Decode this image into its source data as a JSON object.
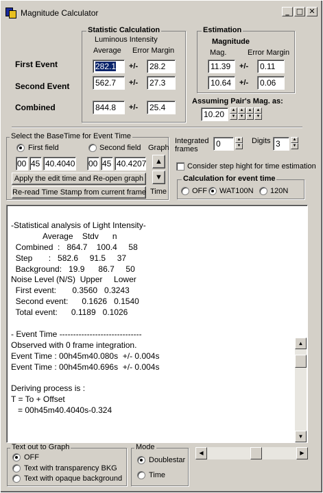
{
  "window": {
    "title": "Magnitude Calculator"
  },
  "statistic": {
    "title": "Statistic Calculation",
    "subtitle": "Luminous Intensity",
    "col_average": "Average",
    "col_error": "Error Margin",
    "row_first": "First Event",
    "row_second": "Second Event",
    "row_combined": "Combined",
    "pm": "+/-",
    "first_avg": "282.1",
    "first_err": "28.2",
    "second_avg": "562.7",
    "second_err": "27.3",
    "combined_avg": "844.8",
    "combined_err": "25.4"
  },
  "estimation": {
    "title": "Estimation",
    "subtitle": "Magnitude",
    "col_mag": "Mag.",
    "col_error": "Error Margin",
    "first_mag": "11.39",
    "first_err": "0.11",
    "second_mag": "10.64",
    "second_err": "0.06",
    "assuming_label": "Assuming Pair's Mag. as:",
    "assuming_value": "10.20"
  },
  "basetime": {
    "title": "Select the BaseTime for Event Time",
    "first_field": "First field",
    "second_field": "Second field",
    "graph": "Graph",
    "time": "Time",
    "first_h": "00",
    "first_m": "45",
    "first_s": "40.4040",
    "second_h": "00",
    "second_m": "45",
    "second_s": "40.4207",
    "apply_button": "Apply the edit time and Re-open graph",
    "reread_button": "Re-read  Time Stamp from current frame",
    "selected": "first"
  },
  "options": {
    "integrated_label": "Integrated frames",
    "integrated_value": "0",
    "digits_label": "Digits",
    "digits_value": "3",
    "step_height_label": "Consider step hight for time estimation",
    "calc_title": "Calculation for event time",
    "opt_off": "OFF",
    "opt_wat": "WAT100N",
    "opt_120": "120N",
    "selected": "WAT100N"
  },
  "output_lines": [
    "-Statistical analysis of Light Intensity-",
    "              Average    Stdv      n",
    "  Combined  :   864.7    100.4     58",
    "  Step       :   582.6     91.5     37",
    "  Background:   19.9      86.7     50",
    "Noise Level (N/S)  Upper     Lower",
    "  First event:       0.3560   0.3243",
    "  Second event:      0.1626   0.1540",
    "  Total event:      0.1189   0.1026",
    "",
    "- Event Time ------------------------------",
    "Observed with 0 frame integration.",
    "Event Time : 00h45m40.080s  +/- 0.004s",
    "Event Time : 00h45m40.696s  +/- 0.004s",
    "",
    "Deriving process is :",
    "T = To + Offset",
    "   = 00h45m40.4040s-0.324"
  ],
  "textout": {
    "title": "Text out to Graph",
    "off": "OFF",
    "transparent": "Text with transparency BKG",
    "opaque": "Text with opaque background",
    "selected": "OFF"
  },
  "mode": {
    "title": "Mode",
    "doublestar": "Doublestar",
    "time": "Time",
    "selected": "Doublestar"
  },
  "scroll": {
    "h_position": 0.56
  },
  "icons": {
    "minimize": "_",
    "maximize": "□",
    "close": "✕",
    "arrow_up": "▲",
    "arrow_down": "▼",
    "arrow_left": "◀",
    "arrow_right": "▶"
  }
}
